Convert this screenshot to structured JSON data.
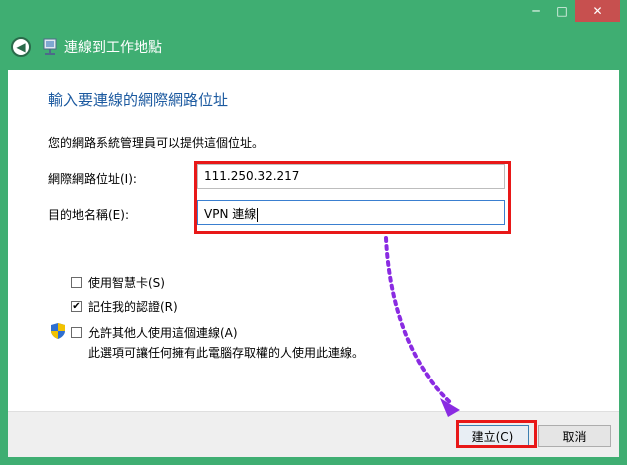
{
  "window": {
    "title": "連線到工作地點",
    "controls": {
      "minimize": "─",
      "maximize": "□",
      "close": "✕"
    }
  },
  "form": {
    "heading": "輸入要連線的網際網路位址",
    "subtitle": "您的網路系統管理員可以提供這個位址。",
    "address_label": "網際網路位址(I):",
    "address_value": "111.250.32.217",
    "destination_label": "目的地名稱(E):",
    "destination_value": "VPN 連線"
  },
  "options": {
    "smart_card": {
      "label": "使用智慧卡(S)",
      "checked": false
    },
    "remember_credentials": {
      "label": "記住我的認證(R)",
      "checked": true,
      "mark": "✔"
    },
    "allow_others": {
      "label": "允許其他人使用這個連線(A)",
      "checked": false
    },
    "allow_others_desc": "此選項可讓任何擁有此電腦存取權的人使用此連線。"
  },
  "buttons": {
    "create": "建立(C)",
    "cancel": "取消"
  },
  "colors": {
    "accent_border": "#3fae72",
    "heading": "#1c5aa0",
    "highlight_red": "#e81818",
    "annotation_arrow": "#8a2be2"
  },
  "icons": [
    "back-arrow-icon",
    "network-icon",
    "shield-icon",
    "checkmark-icon"
  ]
}
